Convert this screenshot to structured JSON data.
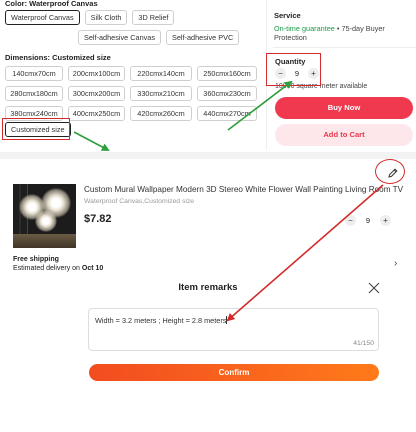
{
  "color_section": {
    "title": "Color: Waterproof Canvas",
    "options": [
      "Waterproof Canvas",
      "Silk Cloth",
      "3D Relief",
      "Self-adhesive Canvas",
      "Self-adhesive PVC"
    ],
    "selected": "Waterproof Canvas"
  },
  "dimensions_section": {
    "title": "Dimensions: Customized size",
    "options": [
      "140cmx70cm",
      "200cmx100cm",
      "220cmx140cm",
      "250cmx160cm",
      "280cmx180cm",
      "300cmx200cm",
      "330cmx210cm",
      "360cmx230cm",
      "380cmx240cm",
      "400cmx250cm",
      "420cmx260cm",
      "440cmx270cm"
    ],
    "custom_option": "Customized size",
    "selected": "Customized size"
  },
  "service": {
    "title": "Service",
    "guarantee": "On-time guarantee",
    "rest": " • 75-day Buyer Protection"
  },
  "quantity": {
    "title": "Quantity",
    "minus": "−",
    "plus": "+",
    "value": "9",
    "available": "10000 square meter available"
  },
  "buttons": {
    "buy_now": "Buy Now",
    "add_to_cart": "Add to Cart"
  },
  "cart_item": {
    "title": "Custom Mural Wallpaper Modern 3D Stereo White Flower Wall Painting Living Room TV So...",
    "variant": "Waterproof Canvas,Customized size",
    "price": "$7.82",
    "quantity": "9",
    "minus": "−",
    "plus": "+",
    "shipping": "Free shipping",
    "delivery_label": "Estimated delivery on ",
    "delivery_date": "Oct 10"
  },
  "remarks": {
    "title": "Item remarks",
    "text": "Width = 3.2 meters ; Height = 2.8 meters",
    "counter": "41/150",
    "confirm": "Confirm"
  },
  "colors": {
    "annotation_red": "#d32b2b",
    "annotation_green": "#2e9e3e",
    "buy_now": "#f0394f",
    "add_to_cart_bg": "#fde7ea",
    "confirm_start": "#f24c20",
    "confirm_end": "#ff7a1a",
    "guarantee_green": "#1a9a4a"
  },
  "icons": [
    "edit-icon",
    "close-icon",
    "chevron-right-icon"
  ]
}
